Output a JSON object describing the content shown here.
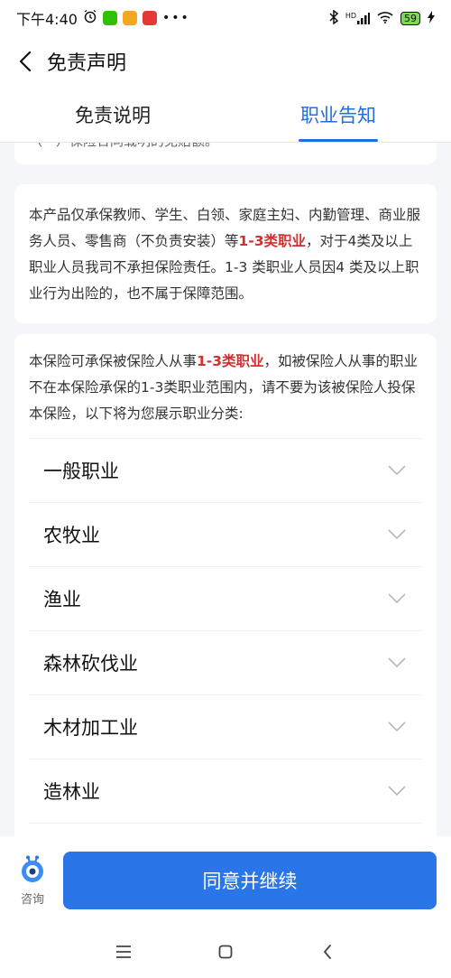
{
  "status_bar": {
    "time": "下午4:40",
    "signal_label": "HD",
    "battery": "59"
  },
  "header": {
    "title": "免责声明"
  },
  "tabs": [
    {
      "label": "免责说明",
      "active": false
    },
    {
      "label": "职业告知",
      "active": true
    }
  ],
  "partial_card": {
    "text": "（一）保险合同载明的免赔额。"
  },
  "notice": {
    "part1": "本产品仅承保教师、学生、白领、家庭主妇、内勤管理、商业服务人员、零售商（不负责安装）等",
    "highlight": "1-3类职业",
    "part2": "，对于4类及以上职业人员我司不承担保险责任。1-3 类职业人员因4 类及以上职业行为出险的，也不属于保障范围。"
  },
  "occupation": {
    "intro_part1": "本保险可承保被保险人从事",
    "intro_highlight": "1-3类职业",
    "intro_part2": "，如被保险人从事的职业不在本保险承保的1-3类职业范围内，请不要为该被保险人投保本保险，以下将为您展示职业分类:",
    "items": [
      {
        "label": "一般职业"
      },
      {
        "label": "农牧业"
      },
      {
        "label": "渔业"
      },
      {
        "label": "森林砍伐业"
      },
      {
        "label": "木材加工业"
      },
      {
        "label": "造林业"
      }
    ]
  },
  "bottom": {
    "consult_label": "咨询",
    "agree_label": "同意并继续"
  },
  "colors": {
    "accent": "#2a75e8",
    "tab_active": "#1f6fe0",
    "highlight": "#d32f2f"
  }
}
